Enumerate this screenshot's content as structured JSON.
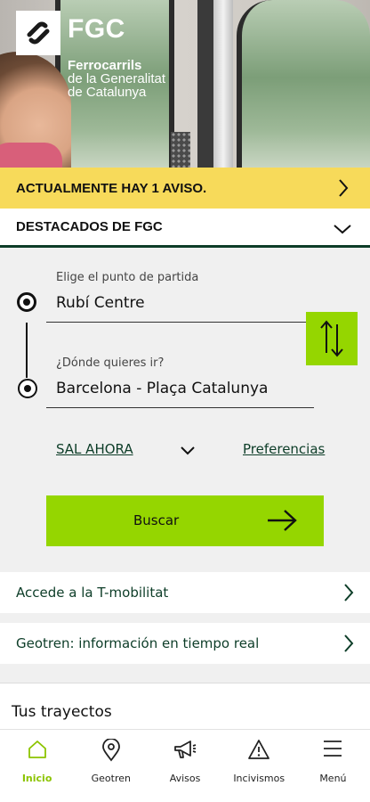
{
  "brand": {
    "name": "FGC",
    "subtitle_lines": [
      "Ferrocarrils",
      "de la Generalitat",
      "de Catalunya"
    ]
  },
  "alert": {
    "text": "ACTUALMENTE HAY 1 AVISO.",
    "icon": "chevron-right-icon",
    "color": "#f7da5a"
  },
  "highlights": {
    "text": "DESTACADOS DE FGC",
    "icon": "chevron-down-icon"
  },
  "journey": {
    "origin_label": "Elige el punto de partida",
    "origin_value": "Rubí Centre",
    "destination_label": "¿Dónde quieres ir?",
    "destination_value": "Barcelona - Plaça Catalunya",
    "swap_icon": "swap-vertical-icon",
    "time_option": "SAL AHORA",
    "preferences": "Preferencias",
    "search_label": "Buscar",
    "accent_color": "#95d600"
  },
  "links": [
    {
      "label": "Accede a la T-mobilitat"
    },
    {
      "label": "Geotren: información en tiempo real"
    }
  ],
  "trips": {
    "title": "Tus trayectos"
  },
  "bottom_nav": [
    {
      "label": "Inicio",
      "icon": "home-icon",
      "active": true
    },
    {
      "label": "Geotren",
      "icon": "location-pin-icon",
      "active": false
    },
    {
      "label": "Avisos",
      "icon": "megaphone-icon",
      "active": false
    },
    {
      "label": "Incivismos",
      "icon": "warning-icon",
      "active": false
    },
    {
      "label": "Menú",
      "icon": "menu-icon",
      "active": false
    }
  ]
}
